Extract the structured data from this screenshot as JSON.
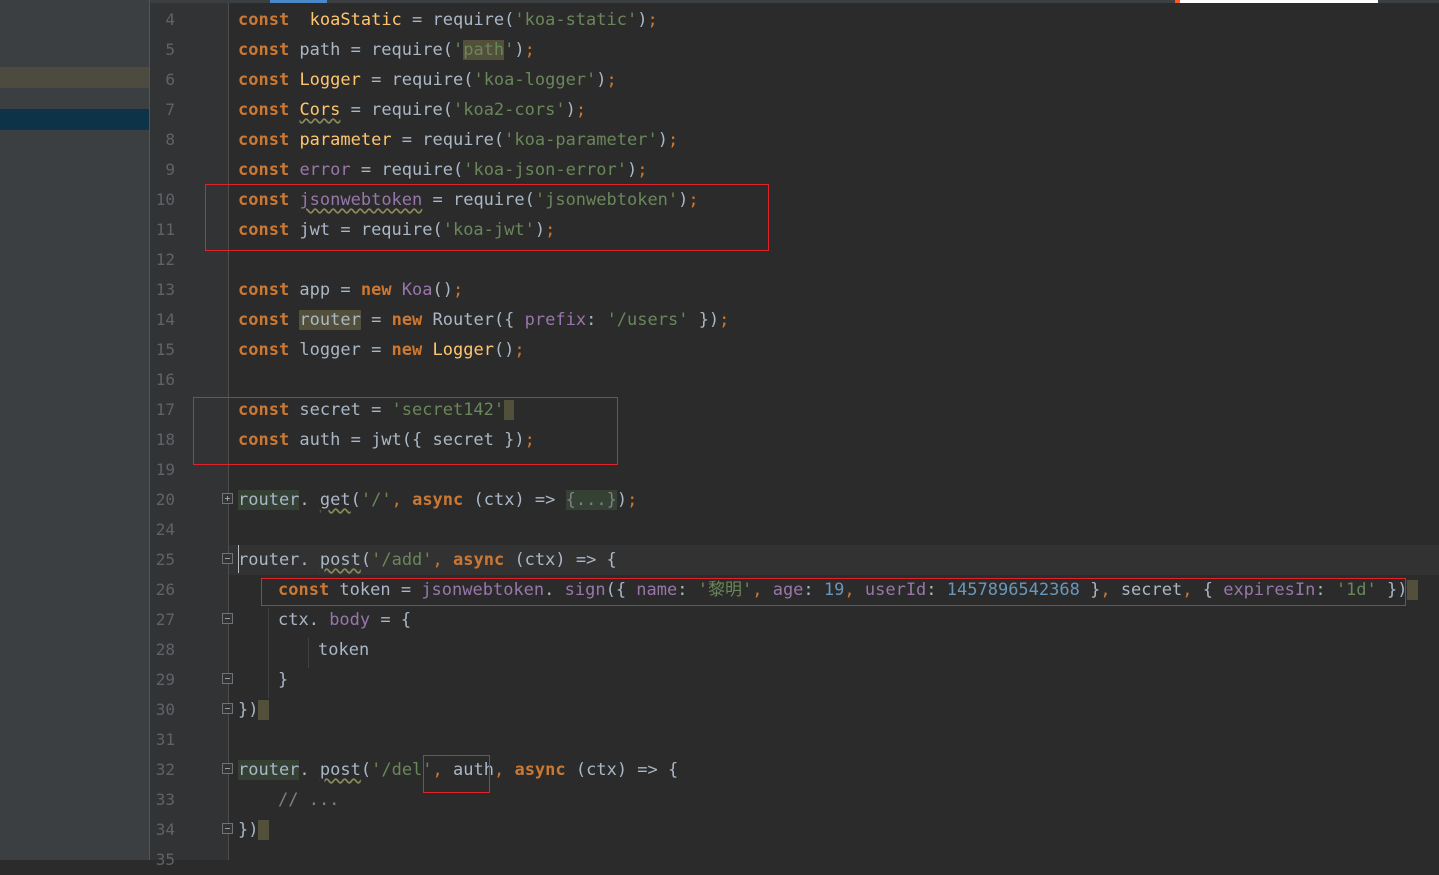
{
  "editor": {
    "lines": [
      {
        "n": "4",
        "segs": [
          [
            "kw",
            "const"
          ],
          [
            "",
            "  "
          ],
          [
            "fn",
            "koaStatic"
          ],
          [
            "",
            " = require("
          ],
          [
            "st",
            "'koa-static'"
          ],
          [
            "",
            ")"
          ],
          [
            "pu",
            ";"
          ]
        ]
      },
      {
        "n": "5",
        "segs": [
          [
            "kw",
            "const"
          ],
          [
            "",
            " path = require("
          ],
          [
            "st",
            "'"
          ],
          [
            "st bg-mark",
            "path"
          ],
          [
            "st",
            "'"
          ],
          [
            "",
            ")"
          ],
          [
            "pu",
            ";"
          ]
        ]
      },
      {
        "n": "6",
        "segs": [
          [
            "kw",
            "const"
          ],
          [
            "",
            " "
          ],
          [
            "fn",
            "Logger"
          ],
          [
            "",
            " = require("
          ],
          [
            "st",
            "'koa-logger'"
          ],
          [
            "",
            ")"
          ],
          [
            "pu",
            ";"
          ]
        ]
      },
      {
        "n": "7",
        "segs": [
          [
            "kw",
            "const"
          ],
          [
            "",
            " "
          ],
          [
            "fn un",
            "Cors"
          ],
          [
            "",
            " = require("
          ],
          [
            "st",
            "'koa2-cors'"
          ],
          [
            "",
            ")"
          ],
          [
            "pu",
            ";"
          ]
        ]
      },
      {
        "n": "8",
        "segs": [
          [
            "kw",
            "const"
          ],
          [
            "",
            " "
          ],
          [
            "fn",
            "parameter"
          ],
          [
            "",
            " = require("
          ],
          [
            "st",
            "'koa-parameter'"
          ],
          [
            "",
            ")"
          ],
          [
            "pu",
            ";"
          ]
        ]
      },
      {
        "n": "9",
        "segs": [
          [
            "kw",
            "const"
          ],
          [
            "",
            " "
          ],
          [
            "pr",
            "error"
          ],
          [
            "",
            " = require("
          ],
          [
            "st",
            "'koa-json-error'"
          ],
          [
            "",
            ")"
          ],
          [
            "pu",
            ";"
          ]
        ]
      },
      {
        "n": "10",
        "segs": [
          [
            "kw",
            "const"
          ],
          [
            "",
            " "
          ],
          [
            "pr un",
            "jsonwebtoken"
          ],
          [
            "",
            " = require("
          ],
          [
            "st",
            "'jsonwebtoken'"
          ],
          [
            "",
            ")"
          ],
          [
            "pu",
            ";"
          ]
        ]
      },
      {
        "n": "11",
        "segs": [
          [
            "kw",
            "const"
          ],
          [
            "",
            " jwt = require("
          ],
          [
            "st",
            "'koa-jwt'"
          ],
          [
            "",
            ")"
          ],
          [
            "pu",
            ";"
          ]
        ]
      },
      {
        "n": "12",
        "segs": []
      },
      {
        "n": "13",
        "segs": [
          [
            "kw",
            "const"
          ],
          [
            "",
            " app = "
          ],
          [
            "kw",
            "new"
          ],
          [
            "",
            " "
          ],
          [
            "pr",
            "Koa"
          ],
          [
            "",
            "()"
          ],
          [
            "pu",
            ";"
          ]
        ]
      },
      {
        "n": "14",
        "segs": [
          [
            "kw",
            "const"
          ],
          [
            "",
            " "
          ],
          [
            "bg-mark",
            "router"
          ],
          [
            "",
            " = "
          ],
          [
            "kw",
            "new"
          ],
          [
            "",
            " Router({ "
          ],
          [
            "pr",
            "prefix"
          ],
          [
            "",
            ": "
          ],
          [
            "st",
            "'/users'"
          ],
          [
            "",
            " })"
          ],
          [
            "pu",
            ";"
          ]
        ]
      },
      {
        "n": "15",
        "segs": [
          [
            "kw",
            "const"
          ],
          [
            "",
            " logger = "
          ],
          [
            "kw",
            "new"
          ],
          [
            "",
            " "
          ],
          [
            "fn",
            "Logger"
          ],
          [
            "",
            "()"
          ],
          [
            "pu",
            ";"
          ]
        ]
      },
      {
        "n": "16",
        "segs": []
      },
      {
        "n": "17",
        "segs": [
          [
            "kw",
            "const"
          ],
          [
            "",
            " secret = "
          ],
          [
            "st",
            "'secret142'"
          ],
          [
            "bg-mark",
            " "
          ]
        ]
      },
      {
        "n": "18",
        "segs": [
          [
            "kw",
            "const"
          ],
          [
            "",
            " auth = jwt({ secret })"
          ],
          [
            "pu",
            ";"
          ]
        ]
      },
      {
        "n": "19",
        "segs": []
      },
      {
        "n": "20",
        "fold": "plus",
        "segs": [
          [
            "bg-hl",
            "router"
          ],
          [
            "",
            ". "
          ],
          [
            "un",
            "get"
          ],
          [
            "",
            "("
          ],
          [
            "st",
            "'/'"
          ],
          [
            "pu",
            ", "
          ],
          [
            "kw",
            "async"
          ],
          [
            "",
            " (ctx) => "
          ],
          [
            "gr bg-hl",
            "{...}"
          ],
          [
            "",
            ")"
          ],
          [
            "pu",
            ";"
          ]
        ]
      },
      {
        "n": "24",
        "segs": []
      },
      {
        "n": "25",
        "fold": "minus",
        "cur": true,
        "segs": [
          [
            "",
            "router"
          ],
          [
            "",
            ". "
          ],
          [
            "un",
            "post"
          ],
          [
            "",
            "("
          ],
          [
            "st",
            "'/add'"
          ],
          [
            "pu",
            ", "
          ],
          [
            "kw",
            "async"
          ],
          [
            "",
            " (ctx) => {"
          ]
        ]
      },
      {
        "n": "26",
        "indent": 1,
        "segs": [
          [
            "kw",
            "const"
          ],
          [
            "",
            " token = "
          ],
          [
            "pr",
            "jsonwebtoken"
          ],
          [
            "",
            ". "
          ],
          [
            "pr",
            "sign"
          ],
          [
            "",
            "({ "
          ],
          [
            "pr",
            "name"
          ],
          [
            "",
            ": "
          ],
          [
            "st",
            "'黎明'"
          ],
          [
            "pu",
            ", "
          ],
          [
            "pr",
            "age"
          ],
          [
            "",
            ": "
          ],
          [
            "nu",
            "19"
          ],
          [
            "pu",
            ", "
          ],
          [
            "pr",
            "userId"
          ],
          [
            "",
            ": "
          ],
          [
            "nu",
            "1457896542368"
          ],
          [
            "",
            " }"
          ],
          [
            "pu",
            ", "
          ],
          [
            "",
            "secret"
          ],
          [
            "pu",
            ", "
          ],
          [
            "",
            "{ "
          ],
          [
            "pr",
            "expiresIn"
          ],
          [
            "",
            ": "
          ],
          [
            "st",
            "'1d'"
          ],
          [
            "",
            " })"
          ],
          [
            "bg-mark",
            " "
          ]
        ]
      },
      {
        "n": "27",
        "fold": "minus",
        "indent": 1,
        "segs": [
          [
            "",
            "ctx. "
          ],
          [
            "pr",
            "body"
          ],
          [
            "",
            " = {"
          ]
        ]
      },
      {
        "n": "28",
        "indent": 2,
        "segs": [
          [
            "",
            "token"
          ]
        ]
      },
      {
        "n": "29",
        "fold": "minus",
        "indent": 1,
        "segs": [
          [
            "",
            "}"
          ]
        ]
      },
      {
        "n": "30",
        "fold": "minus",
        "segs": [
          [
            "",
            "})"
          ],
          [
            "bg-mark",
            " "
          ]
        ]
      },
      {
        "n": "31",
        "segs": []
      },
      {
        "n": "32",
        "fold": "minus",
        "segs": [
          [
            "bg-hl",
            "router"
          ],
          [
            "",
            ". "
          ],
          [
            "un",
            "post"
          ],
          [
            "",
            "("
          ],
          [
            "st",
            "'/del'"
          ],
          [
            "pu",
            ", "
          ],
          [
            "",
            "auth"
          ],
          [
            "pu",
            ", "
          ],
          [
            "kw",
            "async"
          ],
          [
            "",
            " (ctx) => {"
          ]
        ]
      },
      {
        "n": "33",
        "indent": 1,
        "segs": [
          [
            "gr",
            "// ..."
          ]
        ]
      },
      {
        "n": "34",
        "fold": "minus",
        "segs": [
          [
            "",
            "})"
          ],
          [
            "bg-mark",
            " "
          ]
        ]
      },
      {
        "n": "35",
        "segs": []
      }
    ]
  }
}
